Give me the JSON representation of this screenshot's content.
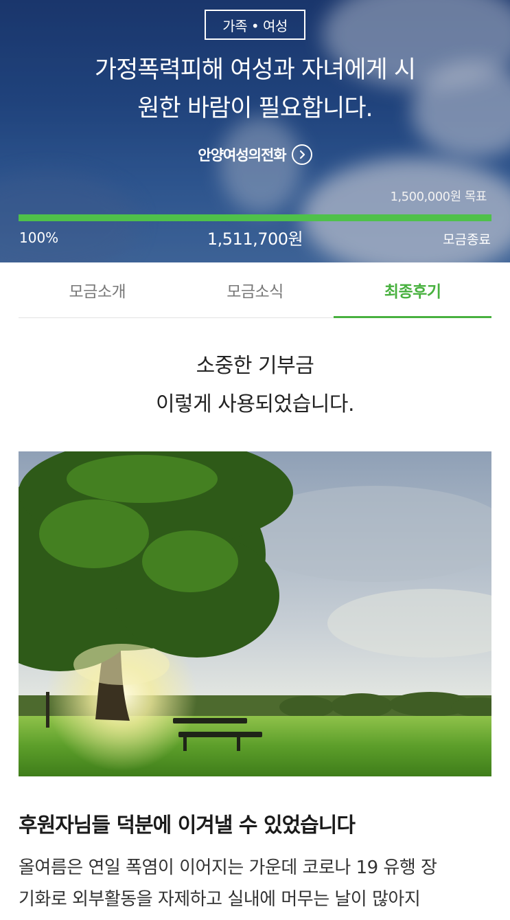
{
  "hero": {
    "category": "가족 • 여성",
    "title_line1": "가정폭력피해 여성과 자녀에게 시",
    "title_line2": "원한 바람이 필요합니다.",
    "organization": "안양여성의전화",
    "goal_label": "1,500,000원 목표",
    "progress_percent": "100%",
    "progress_fraction": 1.0,
    "raised_amount": "1,511,700원",
    "status": "모금종료",
    "accent_color": "#4fc14a"
  },
  "tabs": [
    {
      "label": "모금소개",
      "active": false
    },
    {
      "label": "모금소식",
      "active": false
    },
    {
      "label": "최종후기",
      "active": true
    }
  ],
  "intro": {
    "line1": "소중한 기부금",
    "line2": "이렇게 사용되었습니다."
  },
  "article": {
    "title": "후원자님들 덕분에 이겨낼 수 있었습니다",
    "body_line1": "올여름은 연일 폭염이 이어지는 가운데 코로나 19 유행 장",
    "body_line2": "기화로 외부활동을 자제하고 실내에 머무는 날이 많아지"
  },
  "icons": {
    "org_link": "chevron-right-circle-icon"
  }
}
